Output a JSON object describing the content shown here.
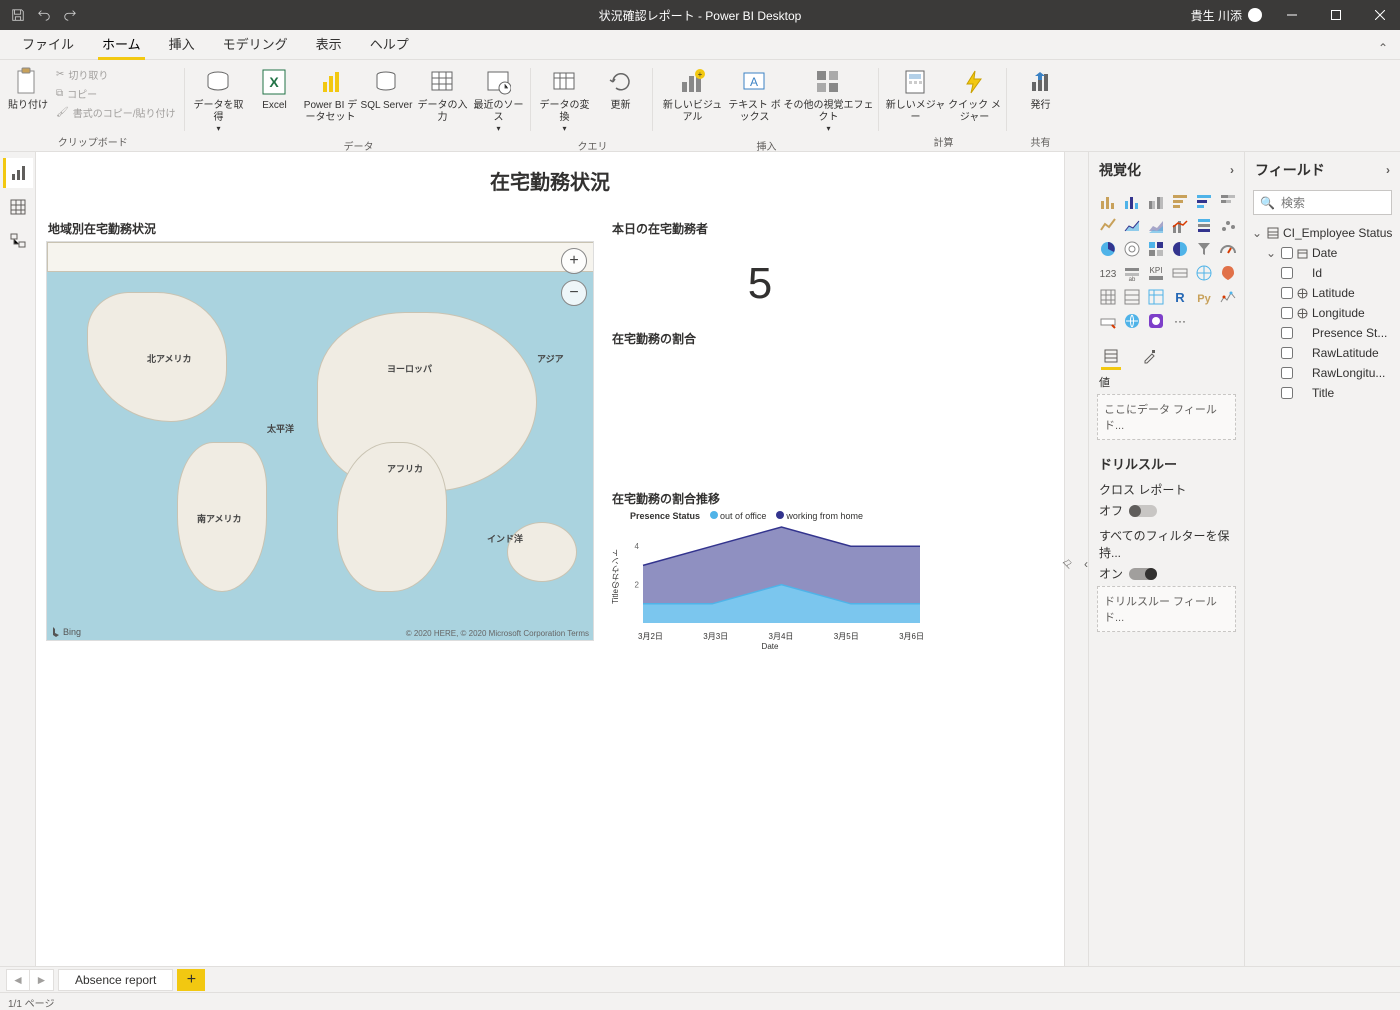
{
  "titlebar": {
    "title": "状況確認レポート - Power BI Desktop",
    "user": "貴生 川添"
  },
  "ribbon_tabs": {
    "file": "ファイル",
    "home": "ホーム",
    "insert": "挿入",
    "modeling": "モデリング",
    "view": "表示",
    "help": "ヘルプ"
  },
  "ribbon": {
    "clipboard": {
      "paste": "貼り付け",
      "cut": "切り取り",
      "copy": "コピー",
      "format_painter": "書式のコピー/貼り付け",
      "group": "クリップボード"
    },
    "data": {
      "get_data": "データを取得",
      "excel": "Excel",
      "pbi_dataset": "Power BI データセット",
      "sql": "SQL Server",
      "enter_data": "データの入力",
      "recent": "最近のソース",
      "group": "データ"
    },
    "query": {
      "transform": "データの変換",
      "refresh": "更新",
      "group": "クエリ"
    },
    "insert": {
      "new_visual": "新しいビジュアル",
      "textbox": "テキスト ボックス",
      "more_visuals": "その他の視覚エフェクト",
      "group": "挿入"
    },
    "calc": {
      "new_measure": "新しいメジャー",
      "quick_measure": "クイック メジャー",
      "group": "計算"
    },
    "share": {
      "publish": "発行",
      "group": "共有"
    }
  },
  "report": {
    "title": "在宅勤務状況",
    "map_title": "地域別在宅勤務状況",
    "card_title": "本日の在宅勤務者",
    "card_value": "5",
    "ratio_title": "在宅勤務の割合",
    "trend_title": "在宅勤務の割合推移",
    "legend_title": "Presence Status",
    "legend_a": "out of office",
    "legend_b": "working from home",
    "yaxis": "Titleのカウント",
    "xaxis": "Date",
    "map": {
      "attrib_left": "Bing",
      "attrib_right": "© 2020 HERE, © 2020 Microsoft Corporation Terms",
      "labels": {
        "na": "北アメリカ",
        "sa": "南アメリカ",
        "eu": "ヨーロッパ",
        "af": "アフリカ",
        "as": "アジア",
        "pac": "太平洋",
        "ind": "インド洋"
      }
    }
  },
  "filters_rail": {
    "label": "フィルター"
  },
  "viz_pane": {
    "header": "視覚化",
    "values_label": "値",
    "field_well_placeholder": "ここにデータ フィールド...",
    "drillthrough": "ドリルスルー",
    "cross_report": "クロス レポート",
    "off": "オフ",
    "keep_filters": "すべてのフィルターを保持...",
    "on": "オン",
    "drill_well_placeholder": "ドリルスルー フィールド..."
  },
  "fields_pane": {
    "header": "フィールド",
    "search_placeholder": "検索",
    "table": "CI_Employee Status",
    "fields": [
      "Date",
      "Id",
      "Latitude",
      "Longitude",
      "Presence St...",
      "RawLatitude",
      "RawLongitu...",
      "Title"
    ]
  },
  "page_tabs": {
    "page1": "Absence report"
  },
  "status": {
    "pages": "1/1 ページ"
  },
  "chart_data": {
    "type": "area",
    "categories": [
      "3月2日",
      "3月3日",
      "3月4日",
      "3月5日",
      "3月6日"
    ],
    "series": [
      {
        "name": "out of office",
        "values": [
          1,
          1,
          2,
          1,
          1
        ],
        "color": "#4fb3e8"
      },
      {
        "name": "working from home",
        "values": [
          3,
          4,
          5,
          4,
          4
        ],
        "color": "#33348e"
      }
    ],
    "ylim": [
      0,
      5
    ],
    "yticks": [
      2,
      4
    ],
    "xlabel": "Date",
    "ylabel": "Titleのカウント",
    "title": "在宅勤務の割合推移"
  }
}
